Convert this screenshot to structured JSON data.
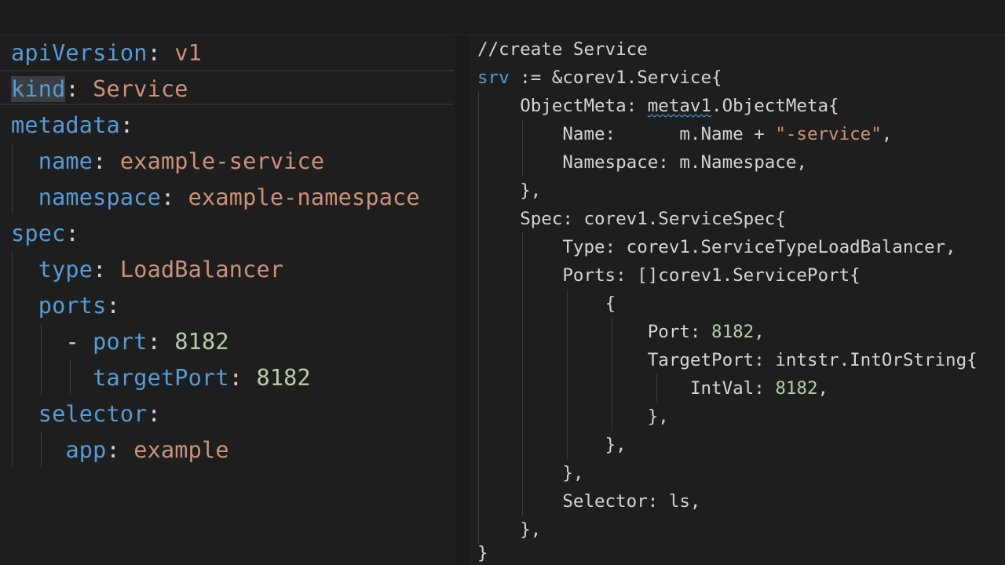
{
  "yaml_editor": {
    "lines": [
      {
        "key": "apiVersion",
        "colon": ":",
        "value": "v1"
      },
      {
        "key": "kind",
        "colon": ":",
        "value": "Service"
      },
      {
        "key": "metadata",
        "colon": ":",
        "value": ""
      },
      {
        "key": "name",
        "colon": ":",
        "value": "example-service"
      },
      {
        "key": "namespace",
        "colon": ":",
        "value": "example-namespace"
      },
      {
        "key": "spec",
        "colon": ":",
        "value": ""
      },
      {
        "key": "type",
        "colon": ":",
        "value": "LoadBalancer"
      },
      {
        "key": "ports",
        "colon": ":",
        "value": ""
      },
      {
        "dash": "-",
        "key": "port",
        "colon": ":",
        "value": "8182"
      },
      {
        "key": "targetPort",
        "colon": ":",
        "value": "8182"
      },
      {
        "key": "selector",
        "colon": ":",
        "value": ""
      },
      {
        "key": "app",
        "colon": ":",
        "value": "example"
      }
    ]
  },
  "go_editor": {
    "comment": "//create Service",
    "l1": {
      "var": "srv",
      "rest": " := &corev1.Service{"
    },
    "l2": {
      "pre": "ObjectMeta: ",
      "type": "metav1",
      "post": ".ObjectMeta{"
    },
    "l3": {
      "pre": "Name:      m.Name + ",
      "str": "\"-service\"",
      "post": ","
    },
    "l4": "Namespace: m.Namespace,",
    "l5": "},",
    "l6": "Spec: corev1.ServiceSpec{",
    "l7": "Type: corev1.ServiceTypeLoadBalancer,",
    "l8": "Ports: []corev1.ServicePort{",
    "l9": "{",
    "l10": {
      "pre": "Port: ",
      "num": "8182",
      "post": ","
    },
    "l11": "TargetPort: intstr.IntOrString{",
    "l12": {
      "pre": "IntVal: ",
      "num": "8182",
      "post": ","
    },
    "l13": "},",
    "l14": "},",
    "l15": "},",
    "l16": "Selector: ls,",
    "l17": "},",
    "l18": "}"
  },
  "colors": {
    "background": "#1e1e1e",
    "key": "#569cd6",
    "string": "#ce9178",
    "number": "#b5cea8",
    "comment": "#6a9955",
    "text": "#d4d4d4"
  }
}
